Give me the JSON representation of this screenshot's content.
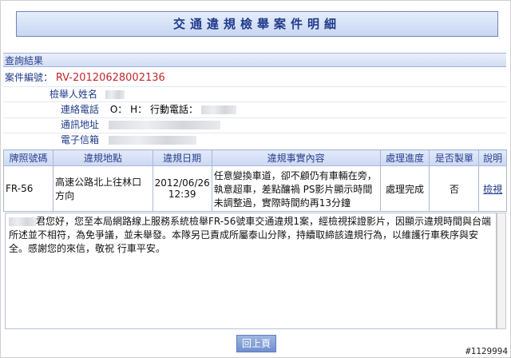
{
  "page": {
    "title": "交通違規檢舉案件明細",
    "result_heading": "查詢結果",
    "watermark": "#1129994"
  },
  "case": {
    "number_label": "案件編號：",
    "number_value": "RV-20120628002136"
  },
  "reporter": {
    "name_label": "檢舉人姓名",
    "phone_label": "連絡電話",
    "phone_value": "O：   H：   行動電話：",
    "address_label": "通訊地址",
    "email_label": "電子信箱"
  },
  "table": {
    "headers": [
      "牌照號碼",
      "違規地點",
      "違規日期",
      "違規事實內容",
      "處理進度",
      "是否製單",
      "說明"
    ],
    "row": {
      "plate": "FR-56",
      "location": "高速公路北上往林口方向",
      "date": "2012/06/26",
      "time": "12:39",
      "fact": "任意變換車道，卻不顧仍有車輛在旁，執意超車，差點釀禍 PS影片顯示時間未調整過，實際時間約再13分鐘",
      "status": "處理完成",
      "ticketed": "否",
      "action": "檢視"
    }
  },
  "reply": {
    "text": "君您好，您至本局網路線上服務系統檢舉FR-56號車交通違規1案，經檢視採證影片，因顯示違規時間與台端所述並不相符，為免爭議，並未舉發。本隊另已責成所屬泰山分隊，持續取締該違規行為，以維護行車秩序與安全。感謝您的來信，敬祝 行車平安。"
  },
  "buttons": {
    "back": "回上頁"
  }
}
